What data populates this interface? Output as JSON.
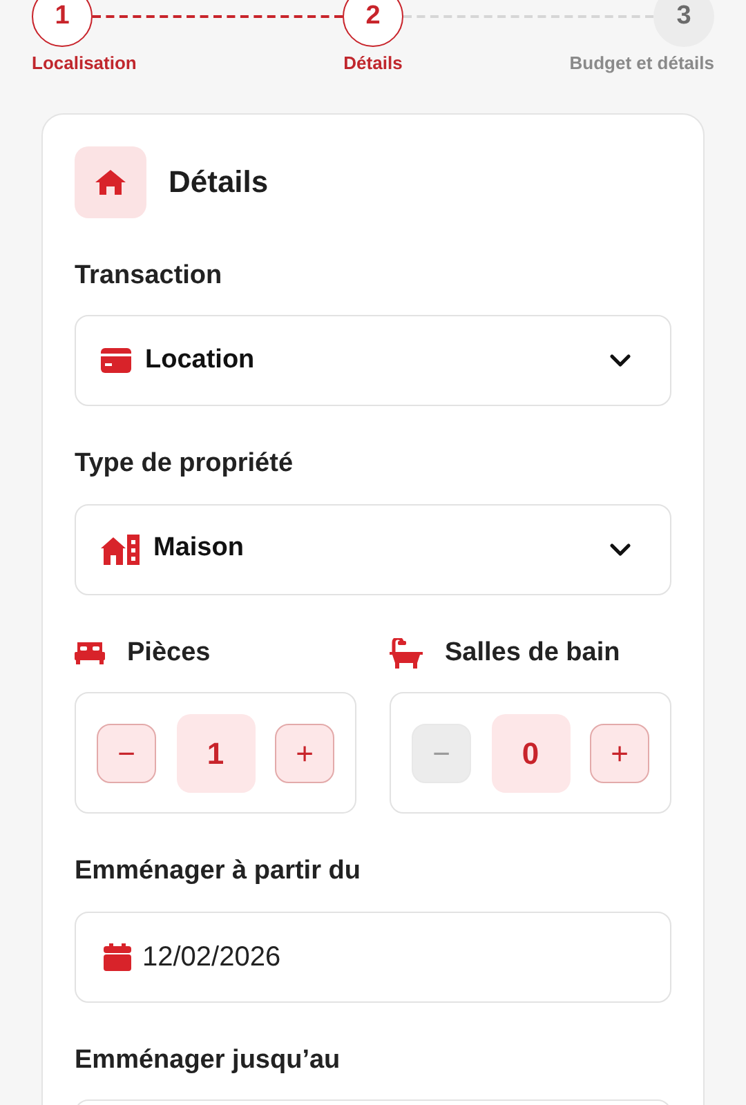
{
  "stepper": [
    {
      "number": "1",
      "label": "Localisation",
      "active": true
    },
    {
      "number": "2",
      "label": "Détails",
      "active": true
    },
    {
      "number": "3",
      "label": "Budget et détails",
      "active": false
    }
  ],
  "card": {
    "title": "Détails",
    "selects": [
      {
        "label": "Transaction",
        "value": "Location",
        "kind": "card"
      },
      {
        "label": "Type de propriété",
        "value": "Maison",
        "kind": "building"
      }
    ],
    "counters": [
      {
        "label": "Pièces",
        "kind": "bed",
        "minus": "−",
        "value": "1",
        "plus": "+",
        "minus_disabled": false
      },
      {
        "label": "Salles de bain",
        "kind": "bath",
        "minus": "−",
        "value": "0",
        "plus": "+",
        "minus_disabled": true
      }
    ],
    "dates": [
      {
        "label": "Emménager à partir du",
        "value": "12/02/2026"
      },
      {
        "label": "Emménager jusqu’au"
      }
    ]
  }
}
